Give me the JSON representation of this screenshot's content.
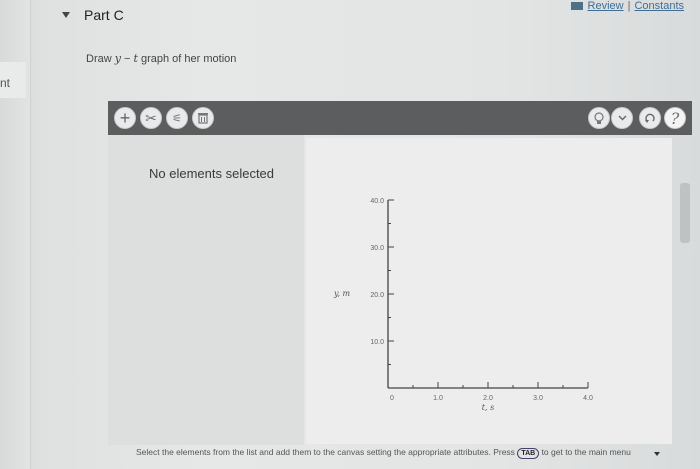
{
  "left_strip": {
    "label": "nt"
  },
  "part": {
    "title": "Part C"
  },
  "links": {
    "review": "Review",
    "separator": "|",
    "constants": "Constants"
  },
  "prompt": {
    "before": "Draw ",
    "var_y": "y",
    "dash": " − ",
    "var_t": "t",
    "after": " graph of her motion"
  },
  "toolbar": {
    "buttons": [
      {
        "name": "add-icon",
        "glyph": "+"
      },
      {
        "name": "scissors-icon",
        "glyph": "✂"
      },
      {
        "name": "edit-attributes-icon",
        "glyph": "⚟"
      },
      {
        "name": "trash-icon",
        "glyph": "🗑"
      }
    ],
    "right_buttons": [
      {
        "name": "hint-bulb-icon",
        "glyph": "☀"
      },
      {
        "name": "dropdown-chevron-icon",
        "glyph": "⌄"
      },
      {
        "name": "reset-icon",
        "glyph": "↺"
      },
      {
        "name": "help-icon",
        "glyph": "?"
      }
    ]
  },
  "selection_panel": {
    "status": "No elements selected"
  },
  "chart_data": {
    "type": "line",
    "xlabel": "t, s",
    "ylabel": "y, m",
    "xlim": [
      0,
      4.0
    ],
    "ylim": [
      0,
      40.0
    ],
    "x_ticks": [
      "0",
      "1.0",
      "2.0",
      "3.0",
      "4.0"
    ],
    "y_ticks": [
      "10.0",
      "20.0",
      "30.0",
      "40.0"
    ],
    "series": []
  },
  "instructions": {
    "text_before": "Select the elements from the list and add them to the canvas setting the appropriate attributes. Press",
    "key": "TAB",
    "text_after": "to get to the main menu"
  },
  "colors": {
    "toolbar_bg": "#5b5d5f",
    "link": "#3f6f96",
    "canvas_bg": "#ecedec"
  }
}
